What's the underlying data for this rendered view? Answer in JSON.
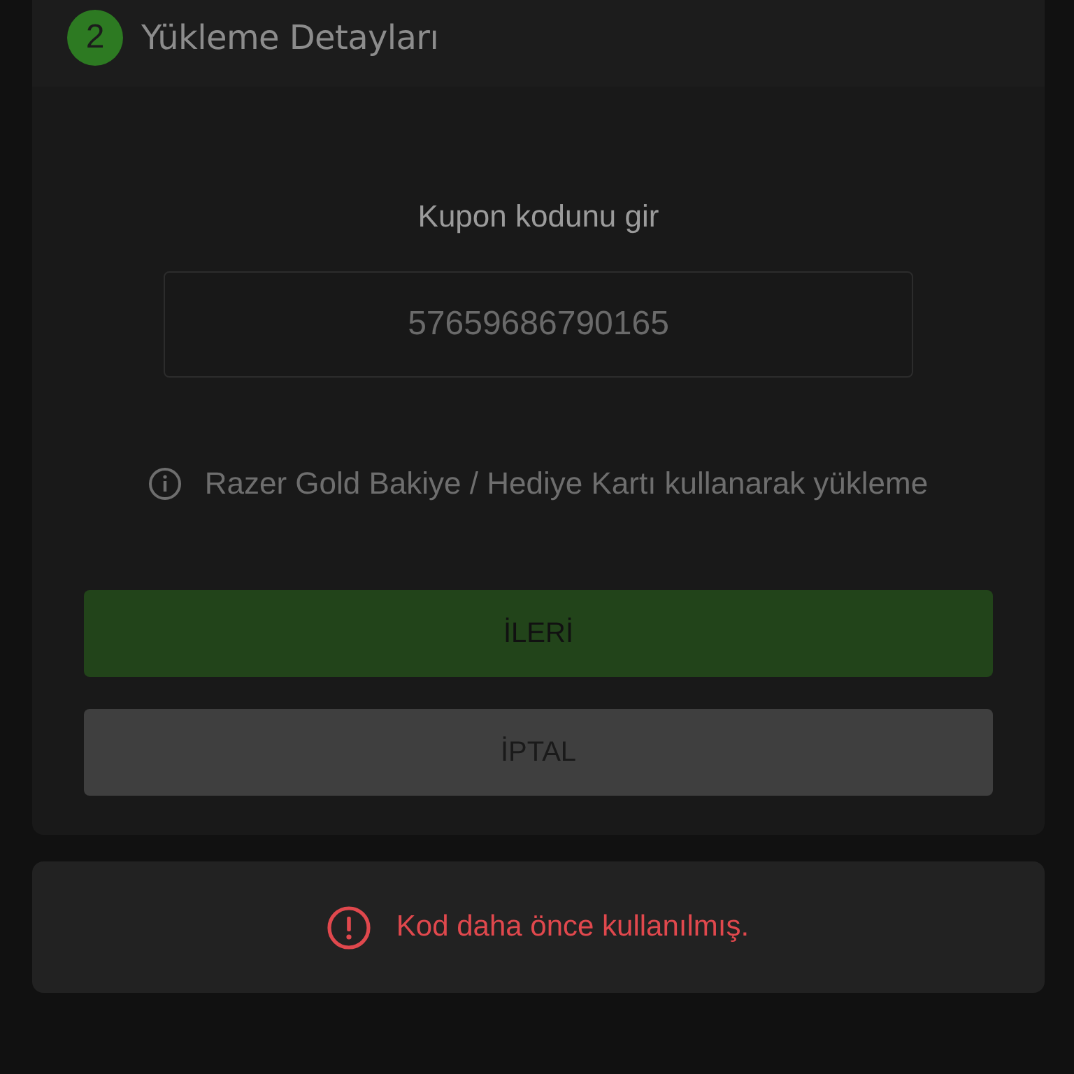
{
  "step": {
    "number": "2",
    "title": "Yükleme Detayları"
  },
  "coupon": {
    "label": "Kupon kodunu gir",
    "value": "57659686790165"
  },
  "info": {
    "text": "Razer Gold Bakiye / Hediye Kartı kullanarak yükleme"
  },
  "buttons": [
    {
      "label": "İLERİ",
      "kind": "primary"
    },
    {
      "label": "İPTAL",
      "kind": "secondary"
    }
  ],
  "error": {
    "message": "Kod daha önce kullanılmış."
  }
}
